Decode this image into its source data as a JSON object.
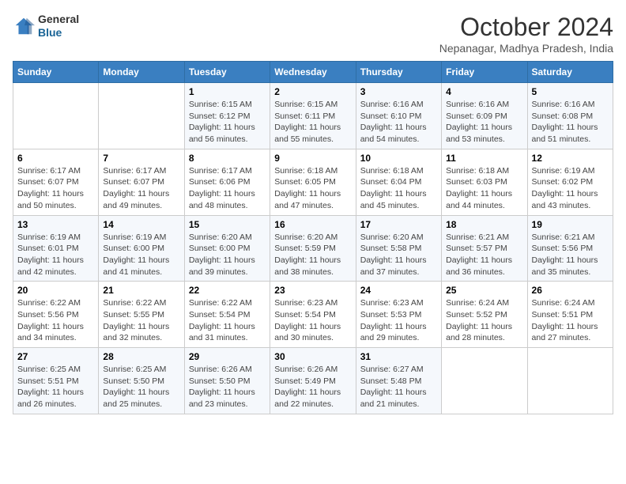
{
  "logo": {
    "general": "General",
    "blue": "Blue"
  },
  "header": {
    "title": "October 2024",
    "location": "Nepanagar, Madhya Pradesh, India"
  },
  "weekdays": [
    "Sunday",
    "Monday",
    "Tuesday",
    "Wednesday",
    "Thursday",
    "Friday",
    "Saturday"
  ],
  "weeks": [
    [
      {
        "day": "",
        "info": ""
      },
      {
        "day": "",
        "info": ""
      },
      {
        "day": "1",
        "sunrise": "Sunrise: 6:15 AM",
        "sunset": "Sunset: 6:12 PM",
        "daylight": "Daylight: 11 hours and 56 minutes."
      },
      {
        "day": "2",
        "sunrise": "Sunrise: 6:15 AM",
        "sunset": "Sunset: 6:11 PM",
        "daylight": "Daylight: 11 hours and 55 minutes."
      },
      {
        "day": "3",
        "sunrise": "Sunrise: 6:16 AM",
        "sunset": "Sunset: 6:10 PM",
        "daylight": "Daylight: 11 hours and 54 minutes."
      },
      {
        "day": "4",
        "sunrise": "Sunrise: 6:16 AM",
        "sunset": "Sunset: 6:09 PM",
        "daylight": "Daylight: 11 hours and 53 minutes."
      },
      {
        "day": "5",
        "sunrise": "Sunrise: 6:16 AM",
        "sunset": "Sunset: 6:08 PM",
        "daylight": "Daylight: 11 hours and 51 minutes."
      }
    ],
    [
      {
        "day": "6",
        "sunrise": "Sunrise: 6:17 AM",
        "sunset": "Sunset: 6:07 PM",
        "daylight": "Daylight: 11 hours and 50 minutes."
      },
      {
        "day": "7",
        "sunrise": "Sunrise: 6:17 AM",
        "sunset": "Sunset: 6:07 PM",
        "daylight": "Daylight: 11 hours and 49 minutes."
      },
      {
        "day": "8",
        "sunrise": "Sunrise: 6:17 AM",
        "sunset": "Sunset: 6:06 PM",
        "daylight": "Daylight: 11 hours and 48 minutes."
      },
      {
        "day": "9",
        "sunrise": "Sunrise: 6:18 AM",
        "sunset": "Sunset: 6:05 PM",
        "daylight": "Daylight: 11 hours and 47 minutes."
      },
      {
        "day": "10",
        "sunrise": "Sunrise: 6:18 AM",
        "sunset": "Sunset: 6:04 PM",
        "daylight": "Daylight: 11 hours and 45 minutes."
      },
      {
        "day": "11",
        "sunrise": "Sunrise: 6:18 AM",
        "sunset": "Sunset: 6:03 PM",
        "daylight": "Daylight: 11 hours and 44 minutes."
      },
      {
        "day": "12",
        "sunrise": "Sunrise: 6:19 AM",
        "sunset": "Sunset: 6:02 PM",
        "daylight": "Daylight: 11 hours and 43 minutes."
      }
    ],
    [
      {
        "day": "13",
        "sunrise": "Sunrise: 6:19 AM",
        "sunset": "Sunset: 6:01 PM",
        "daylight": "Daylight: 11 hours and 42 minutes."
      },
      {
        "day": "14",
        "sunrise": "Sunrise: 6:19 AM",
        "sunset": "Sunset: 6:00 PM",
        "daylight": "Daylight: 11 hours and 41 minutes."
      },
      {
        "day": "15",
        "sunrise": "Sunrise: 6:20 AM",
        "sunset": "Sunset: 6:00 PM",
        "daylight": "Daylight: 11 hours and 39 minutes."
      },
      {
        "day": "16",
        "sunrise": "Sunrise: 6:20 AM",
        "sunset": "Sunset: 5:59 PM",
        "daylight": "Daylight: 11 hours and 38 minutes."
      },
      {
        "day": "17",
        "sunrise": "Sunrise: 6:20 AM",
        "sunset": "Sunset: 5:58 PM",
        "daylight": "Daylight: 11 hours and 37 minutes."
      },
      {
        "day": "18",
        "sunrise": "Sunrise: 6:21 AM",
        "sunset": "Sunset: 5:57 PM",
        "daylight": "Daylight: 11 hours and 36 minutes."
      },
      {
        "day": "19",
        "sunrise": "Sunrise: 6:21 AM",
        "sunset": "Sunset: 5:56 PM",
        "daylight": "Daylight: 11 hours and 35 minutes."
      }
    ],
    [
      {
        "day": "20",
        "sunrise": "Sunrise: 6:22 AM",
        "sunset": "Sunset: 5:56 PM",
        "daylight": "Daylight: 11 hours and 34 minutes."
      },
      {
        "day": "21",
        "sunrise": "Sunrise: 6:22 AM",
        "sunset": "Sunset: 5:55 PM",
        "daylight": "Daylight: 11 hours and 32 minutes."
      },
      {
        "day": "22",
        "sunrise": "Sunrise: 6:22 AM",
        "sunset": "Sunset: 5:54 PM",
        "daylight": "Daylight: 11 hours and 31 minutes."
      },
      {
        "day": "23",
        "sunrise": "Sunrise: 6:23 AM",
        "sunset": "Sunset: 5:54 PM",
        "daylight": "Daylight: 11 hours and 30 minutes."
      },
      {
        "day": "24",
        "sunrise": "Sunrise: 6:23 AM",
        "sunset": "Sunset: 5:53 PM",
        "daylight": "Daylight: 11 hours and 29 minutes."
      },
      {
        "day": "25",
        "sunrise": "Sunrise: 6:24 AM",
        "sunset": "Sunset: 5:52 PM",
        "daylight": "Daylight: 11 hours and 28 minutes."
      },
      {
        "day": "26",
        "sunrise": "Sunrise: 6:24 AM",
        "sunset": "Sunset: 5:51 PM",
        "daylight": "Daylight: 11 hours and 27 minutes."
      }
    ],
    [
      {
        "day": "27",
        "sunrise": "Sunrise: 6:25 AM",
        "sunset": "Sunset: 5:51 PM",
        "daylight": "Daylight: 11 hours and 26 minutes."
      },
      {
        "day": "28",
        "sunrise": "Sunrise: 6:25 AM",
        "sunset": "Sunset: 5:50 PM",
        "daylight": "Daylight: 11 hours and 25 minutes."
      },
      {
        "day": "29",
        "sunrise": "Sunrise: 6:26 AM",
        "sunset": "Sunset: 5:50 PM",
        "daylight": "Daylight: 11 hours and 23 minutes."
      },
      {
        "day": "30",
        "sunrise": "Sunrise: 6:26 AM",
        "sunset": "Sunset: 5:49 PM",
        "daylight": "Daylight: 11 hours and 22 minutes."
      },
      {
        "day": "31",
        "sunrise": "Sunrise: 6:27 AM",
        "sunset": "Sunset: 5:48 PM",
        "daylight": "Daylight: 11 hours and 21 minutes."
      },
      {
        "day": "",
        "info": ""
      },
      {
        "day": "",
        "info": ""
      }
    ]
  ]
}
